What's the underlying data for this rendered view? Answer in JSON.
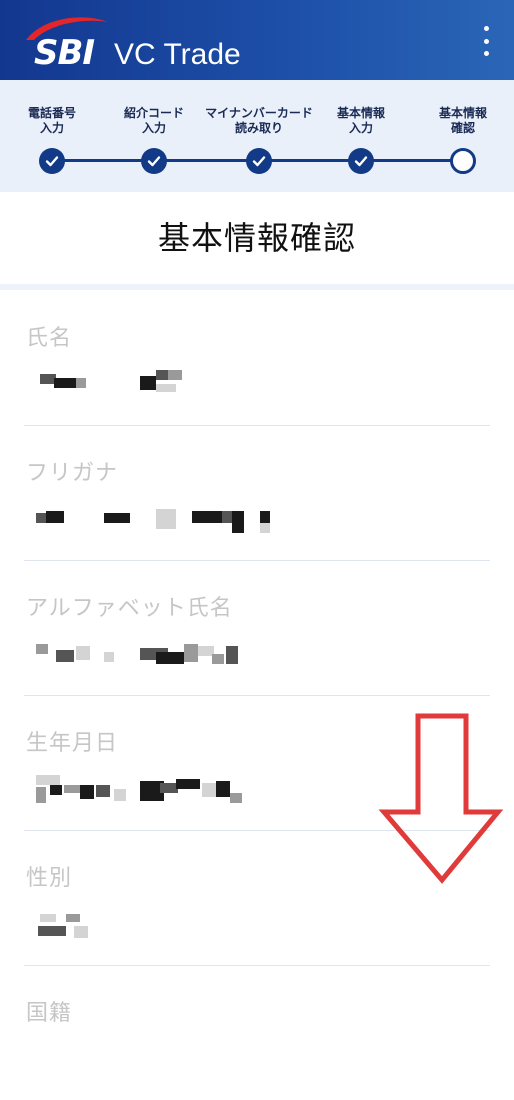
{
  "header": {
    "logo_sbi": "SBI",
    "logo_vc": "VC Trade",
    "menu_icon": "more-vertical-icon",
    "brand_color": "#13378f"
  },
  "stepper": {
    "steps": [
      {
        "label": "電話番号\n入力",
        "status": "done"
      },
      {
        "label": "紹介コード\n入力",
        "status": "done"
      },
      {
        "label": "マイナンバーカード\n読み取り",
        "status": "done"
      },
      {
        "label": "基本情報\n入力",
        "status": "done"
      },
      {
        "label": "基本情報\n確認",
        "status": "current"
      }
    ]
  },
  "page": {
    "title": "基本情報確認"
  },
  "fields": [
    {
      "label": "氏名"
    },
    {
      "label": "フリガナ"
    },
    {
      "label": "アルファベット氏名"
    },
    {
      "label": "生年月日"
    },
    {
      "label": "性別"
    },
    {
      "label": "国籍"
    }
  ],
  "annotation": {
    "arrow_color": "#e03a3a"
  }
}
